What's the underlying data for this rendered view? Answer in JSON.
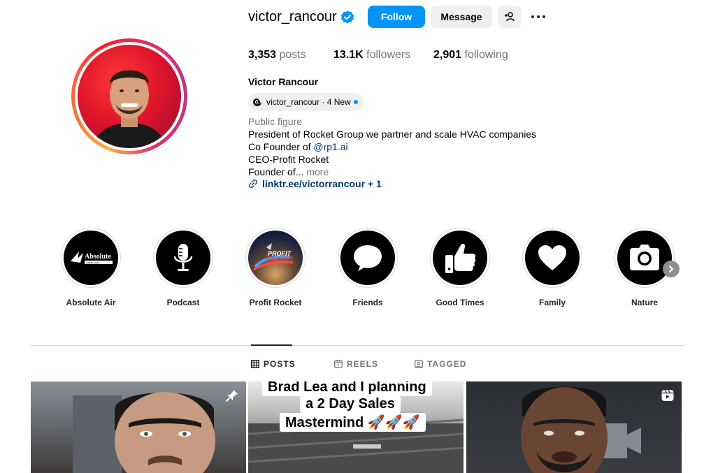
{
  "profile": {
    "username": "victor_rancour",
    "full_name": "Victor Rancour",
    "verified": true,
    "threads_handle": "victor_rancour",
    "threads_new": "· 4 New",
    "category": "Public figure",
    "bio_lines": [
      "President of Rocket Group we partner and scale HVAC companies",
      "Co Founder of ",
      "CEO-Profit Rocket",
      "Founder of..."
    ],
    "bio_mention": "@rp1.ai",
    "bio_more": " more",
    "link": "linktr.ee/victorrancour + 1"
  },
  "actions": {
    "follow": "Follow",
    "message": "Message"
  },
  "stats": {
    "posts_count": "3,353",
    "posts_label": " posts",
    "followers_count": "13.1K",
    "followers_label": " followers",
    "following_count": "2,901",
    "following_label": " following"
  },
  "highlights": [
    {
      "label": "Absolute Air",
      "icon": "absolute-air-logo"
    },
    {
      "label": "Podcast",
      "icon": "microphone-icon"
    },
    {
      "label": "Profit Rocket",
      "icon": "profit-rocket-logo"
    },
    {
      "label": "Friends",
      "icon": "speech-bubble-icon"
    },
    {
      "label": "Good Times",
      "icon": "thumbs-up-icon"
    },
    {
      "label": "Family",
      "icon": "heart-icon"
    },
    {
      "label": "Nature",
      "icon": "camera-icon"
    }
  ],
  "highlight_logo_text": {
    "absolute_air_1": "Absolute",
    "absolute_air_2": "AIRFLOW",
    "profit_rocket_1": "PROFIT",
    "profit_rocket_2": "ROCKET"
  },
  "tabs": [
    {
      "label": "POSTS",
      "icon": "grid-icon",
      "active": true
    },
    {
      "label": "REELS",
      "icon": "reels-icon",
      "active": false
    },
    {
      "label": "TAGGED",
      "icon": "tagged-icon",
      "active": false
    }
  ],
  "posts": [
    {
      "type": "pinned",
      "icon": "pin-icon"
    },
    {
      "type": "image",
      "caption_lines": [
        "Brad Lea and I planning",
        "a 2 Day Sales",
        "Mastermind 🚀🚀🚀"
      ]
    },
    {
      "type": "reel",
      "icon": "reel-icon"
    }
  ],
  "colors": {
    "accent": "#0095f6",
    "link": "#00376b",
    "secondary_text": "#737373",
    "button_bg": "#efefef"
  }
}
